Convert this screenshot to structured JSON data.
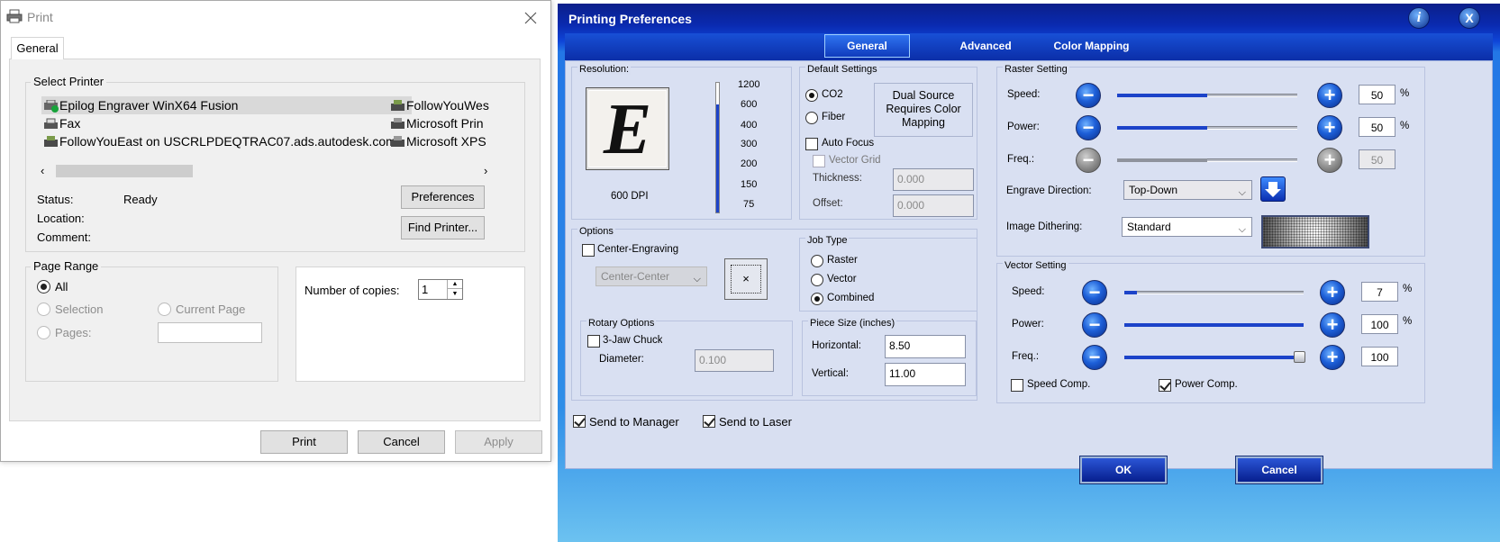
{
  "print_dialog": {
    "title": "Print",
    "tab": "General",
    "select_printer_label": "Select Printer",
    "printers": [
      "Epilog Engraver WinX64 Fusion",
      "Fax",
      "FollowYouEast on USCRLPDEQTRAC07.ads.autodesk.com",
      "FollowYouWes",
      "Microsoft Prin",
      "Microsoft XPS"
    ],
    "status_label": "Status:",
    "status_value": "Ready",
    "location_label": "Location:",
    "comment_label": "Comment:",
    "preferences_button": "Preferences",
    "find_printer_button": "Find Printer...",
    "page_range_label": "Page Range",
    "all_label": "All",
    "selection_label": "Selection",
    "current_page_label": "Current Page",
    "pages_label": "Pages:",
    "copies_label": "Number of copies:",
    "copies_value": "1",
    "print_button": "Print",
    "cancel_button": "Cancel",
    "apply_button": "Apply"
  },
  "prefs": {
    "title": "Printing Preferences",
    "info_glyph": "i",
    "close_glyph": "X",
    "tabs": [
      "General",
      "Advanced",
      "Color Mapping"
    ],
    "active_tab": "General",
    "resolution": {
      "label": "Resolution:",
      "preview_letter": "E",
      "dpi_label": "600 DPI",
      "ticks": [
        "1200",
        "600",
        "400",
        "300",
        "200",
        "150",
        "75"
      ],
      "value_fraction": 0.83
    },
    "default_settings": {
      "label": "Default Settings",
      "co2": "CO2",
      "fiber": "Fiber",
      "dual_source": "Dual Source Requires Color Mapping",
      "auto_focus": "Auto Focus",
      "vector_grid": "Vector Grid",
      "thickness_label": "Thickness:",
      "thickness_value": "0.000",
      "offset_label": "Offset:",
      "offset_value": "0.000"
    },
    "options": {
      "label": "Options",
      "center_engraving": "Center-Engraving",
      "center_select": "Center-Center",
      "center_glyph": "×"
    },
    "job_type": {
      "label": "Job Type",
      "raster": "Raster",
      "vector": "Vector",
      "combined": "Combined"
    },
    "rotary": {
      "label": "Rotary Options",
      "chuck": "3-Jaw Chuck",
      "diameter_label": "Diameter:",
      "diameter_value": "0.100"
    },
    "piece_size": {
      "label": "Piece Size (inches)",
      "horizontal_label": "Horizontal:",
      "horizontal_value": "8.50",
      "vertical_label": "Vertical:",
      "vertical_value": "11.00"
    },
    "raster": {
      "label": "Raster Setting",
      "speed_label": "Speed:",
      "speed_value": "50",
      "power_label": "Power:",
      "power_value": "50",
      "freq_label": "Freq.:",
      "freq_value": "50",
      "unit": "%",
      "speed_fraction": 0.5,
      "power_fraction": 0.5,
      "freq_fraction": 0.5,
      "engrave_direction_label": "Engrave Direction:",
      "engrave_direction_value": "Top-Down",
      "dithering_label": "Image Dithering:",
      "dithering_value": "Standard"
    },
    "vector": {
      "label": "Vector Setting",
      "speed_label": "Speed:",
      "speed_value": "7",
      "power_label": "Power:",
      "power_value": "100",
      "freq_label": "Freq.:",
      "freq_value": "100",
      "unit": "%",
      "speed_fraction": 0.07,
      "power_fraction": 1.0,
      "freq_fraction": 1.0,
      "speed_comp": "Speed Comp.",
      "power_comp": "Power Comp."
    },
    "send_to_manager": "Send to Manager",
    "send_to_laser": "Send to Laser",
    "ok_button": "OK",
    "cancel_button": "Cancel",
    "minus": "−",
    "plus": "+",
    "dropdown_arrow": "⌵"
  }
}
